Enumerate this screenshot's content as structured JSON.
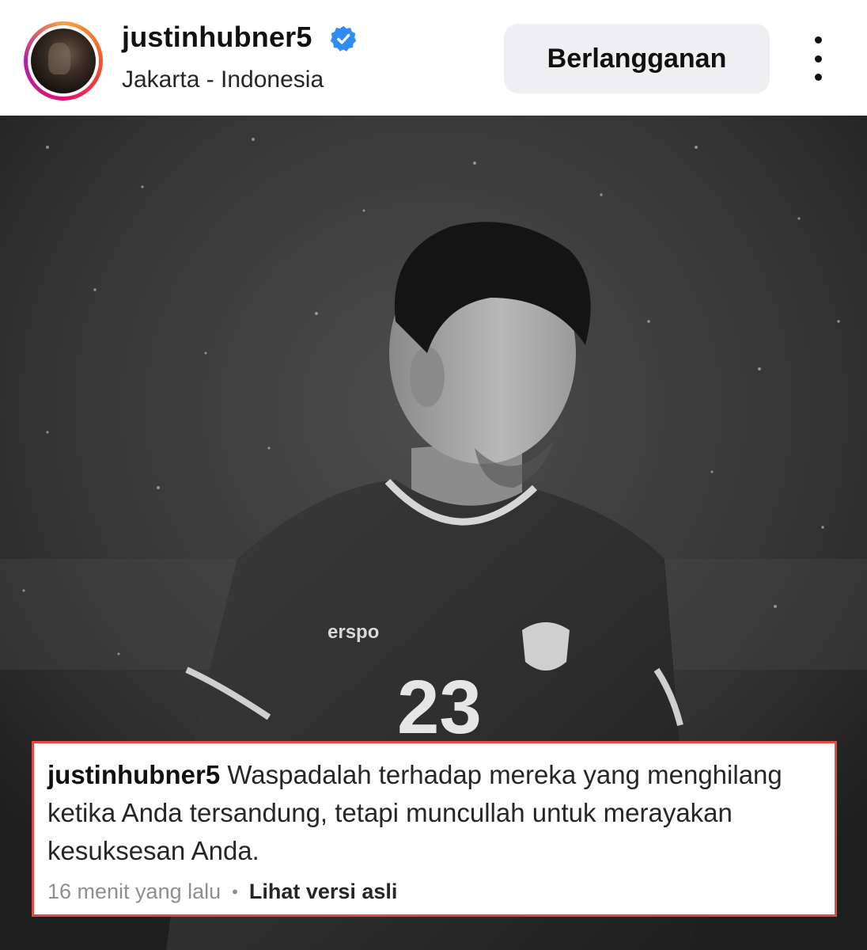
{
  "header": {
    "username": "justinhubner5",
    "location": "Jakarta - Indonesia",
    "subscribe_label": "Berlangganan",
    "verified_icon": "verified-badge-icon",
    "more_icon": "more-vertical-icon"
  },
  "photo": {
    "jersey_brand": "erspo",
    "jersey_number": "23"
  },
  "caption": {
    "username": "justinhubner5",
    "text": "Waspadalah terhadap mereka yang menghilang ketika Anda tersandung, tetapi muncullah untuk merayakan kesuksesan Anda.",
    "time": "16 menit yang lalu",
    "separator": "•",
    "see_original": "Lihat versi asli"
  },
  "colors": {
    "verified": "#2f8cf0",
    "caption_border": "#e04a44",
    "button_bg": "#efeff1"
  }
}
